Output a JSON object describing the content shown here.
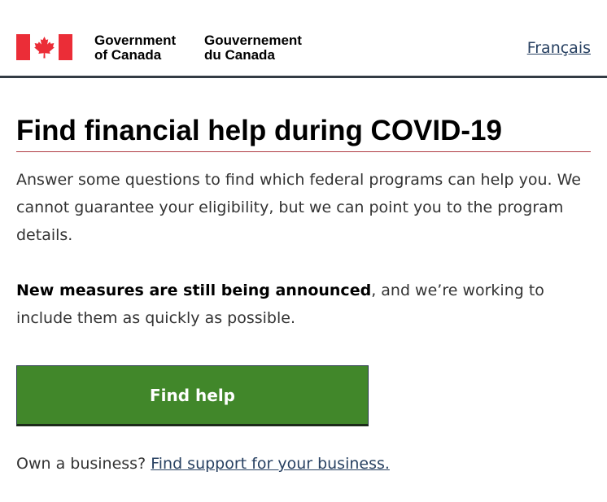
{
  "header": {
    "signature_en_line1": "Government",
    "signature_en_line2": "of Canada",
    "signature_fr_line1": "Gouvernement",
    "signature_fr_line2": "du Canada",
    "language_toggle": "Français"
  },
  "main": {
    "title": "Find financial help during COVID-19",
    "intro": "Answer some questions to find which federal programs can help you. We cannot guarantee your eligibility, but we can point you to the program details.",
    "notice_bold": "New measures are still being announced",
    "notice_rest": ", and we’re working to include them as quickly as possible.",
    "button_label": "Find help",
    "business_prefix": "Own a business?",
    "business_link": "Find support for your business."
  },
  "colors": {
    "flag_red": "#eb2d37",
    "button_green": "#41872a",
    "link_blue": "#284162",
    "title_rule": "#af3c43"
  }
}
